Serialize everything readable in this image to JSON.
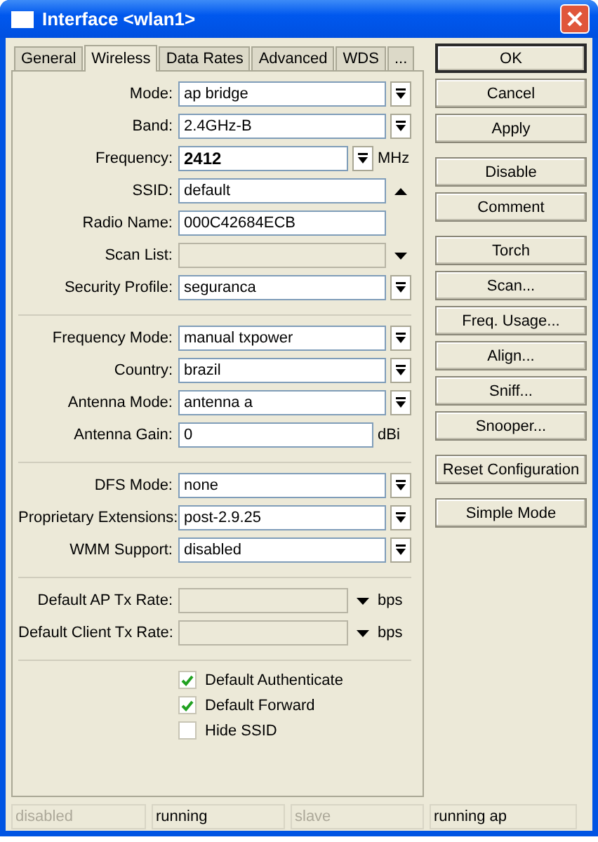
{
  "window": {
    "title": "Interface <wlan1>"
  },
  "tabs": [
    {
      "label": "General",
      "selected": false
    },
    {
      "label": "Wireless",
      "selected": true
    },
    {
      "label": "Data Rates",
      "selected": false
    },
    {
      "label": "Advanced",
      "selected": false
    },
    {
      "label": "WDS",
      "selected": false
    },
    {
      "label": "...",
      "selected": false
    }
  ],
  "sections": [
    {
      "rows": [
        {
          "label": "Mode:",
          "kind": "select",
          "value": "ap bridge"
        },
        {
          "label": "Band:",
          "kind": "select",
          "value": "2.4GHz-B"
        },
        {
          "label": "Frequency:",
          "kind": "select",
          "value": "2412",
          "emphasized": true,
          "unit": "MHz"
        },
        {
          "label": "SSID:",
          "kind": "arrow-up",
          "value": "default"
        },
        {
          "label": "Radio Name:",
          "kind": "text",
          "value": "000C42684ECB"
        },
        {
          "label": "Scan List:",
          "kind": "arrow-down",
          "disabled": true
        },
        {
          "label": "Security Profile:",
          "kind": "select",
          "value": "seguranca"
        }
      ]
    },
    {
      "rows": [
        {
          "label": "Frequency Mode:",
          "kind": "select",
          "value": "manual txpower"
        },
        {
          "label": "Country:",
          "kind": "select",
          "value": "brazil"
        },
        {
          "label": "Antenna Mode:",
          "kind": "select",
          "value": "antenna a"
        },
        {
          "label": "Antenna Gain:",
          "kind": "text",
          "value": "0",
          "unit": "dBi"
        }
      ]
    },
    {
      "rows": [
        {
          "label": "DFS Mode:",
          "kind": "select",
          "value": "none"
        },
        {
          "label": "Proprietary Extensions:",
          "kind": "select",
          "value": "post-2.9.25"
        },
        {
          "label": "WMM Support:",
          "kind": "select",
          "value": "disabled"
        }
      ]
    },
    {
      "rows": [
        {
          "label": "Default AP Tx Rate:",
          "kind": "arrow-down",
          "disabled": true,
          "unit": "bps"
        },
        {
          "label": "Default Client Tx Rate:",
          "kind": "arrow-down",
          "disabled": true,
          "unit": "bps"
        }
      ]
    }
  ],
  "checkboxes": [
    {
      "label": "Default Authenticate",
      "checked": true
    },
    {
      "label": "Default Forward",
      "checked": true
    },
    {
      "label": "Hide SSID",
      "checked": false
    }
  ],
  "button_groups": [
    {
      "buttons": [
        {
          "label": "OK",
          "default": true
        },
        {
          "label": "Cancel",
          "default": false
        },
        {
          "label": "Apply",
          "default": false
        }
      ]
    },
    {
      "buttons": [
        {
          "label": "Disable",
          "default": false
        },
        {
          "label": "Comment",
          "default": false
        }
      ]
    },
    {
      "buttons": [
        {
          "label": "Torch",
          "default": false
        },
        {
          "label": "Scan...",
          "default": false
        },
        {
          "label": "Freq. Usage...",
          "default": false
        },
        {
          "label": "Align...",
          "default": false
        },
        {
          "label": "Sniff...",
          "default": false
        },
        {
          "label": "Snooper...",
          "default": false
        }
      ]
    },
    {
      "buttons": [
        {
          "label": "Reset Configuration",
          "default": false
        }
      ]
    },
    {
      "buttons": [
        {
          "label": "Simple Mode",
          "default": false
        }
      ]
    }
  ],
  "status_bar": [
    {
      "text": "disabled",
      "disabled": true
    },
    {
      "text": "running",
      "disabled": false
    },
    {
      "text": "slave",
      "disabled": true
    },
    {
      "text": "running ap",
      "disabled": false
    }
  ]
}
